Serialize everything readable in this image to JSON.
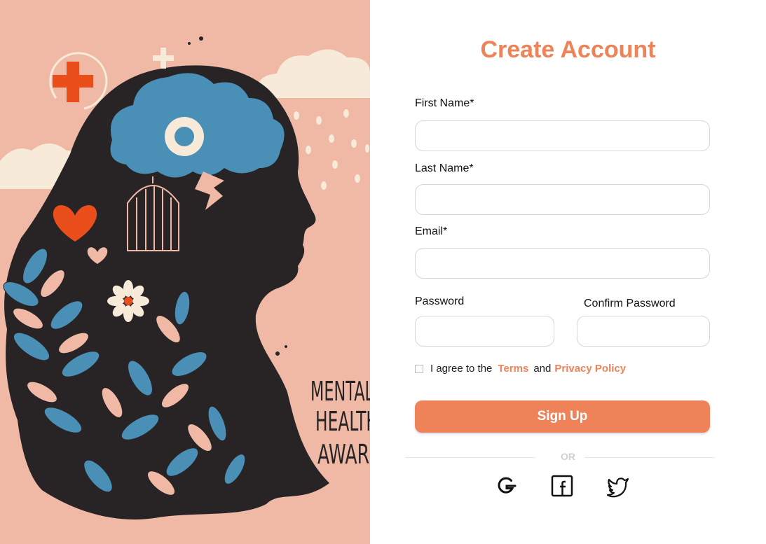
{
  "form": {
    "title": "Create Account",
    "first_name_label": "First Name*",
    "last_name_label": "Last Name*",
    "email_label": "Email*",
    "password_label": "Password",
    "confirm_password_label": "Confirm Password",
    "first_name_value": "",
    "last_name_value": "",
    "email_value": "",
    "password_value": "",
    "confirm_password_value": "",
    "agree_prefix": "I agree to the",
    "terms_link": "Terms",
    "agree_and": "and",
    "privacy_link": "Privacy Policy",
    "signup_label": "Sign Up",
    "or_text": "OR"
  },
  "social": [
    "google-icon",
    "facebook-icon",
    "twitter-icon"
  ],
  "illustration": {
    "text_lines": [
      "MENTAL",
      "HEALTH",
      "AWARE"
    ]
  },
  "colors": {
    "accent": "#ee835a",
    "illustration_bg": "#f0b9a6",
    "silhouette": "#282426",
    "brain": "#4a8fb5",
    "red": "#e94e1b"
  }
}
